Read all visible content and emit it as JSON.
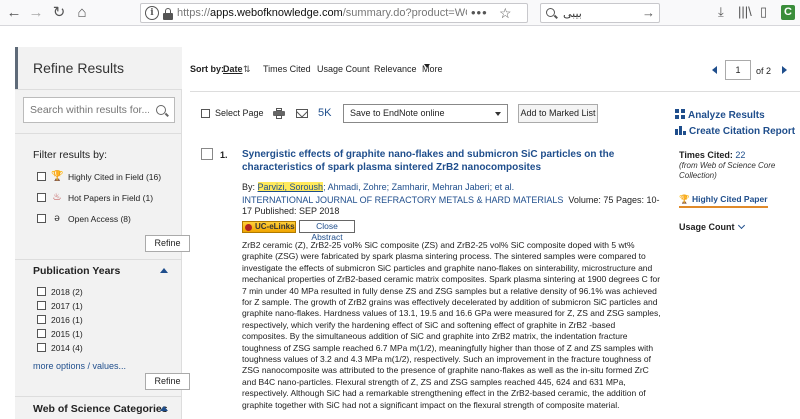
{
  "browser": {
    "url_domain": "apps.webofknowledge.com",
    "url_rest": "/summary.do?product=WOS&search_mode",
    "url_prefix": "https://",
    "search_value": "بیبی",
    "menu_dots": "•••"
  },
  "sidebar": {
    "title": "Refine Results",
    "search_placeholder": "Search within results for...",
    "filter_title": "Filter results by:",
    "filters": [
      {
        "label": "Highly Cited in Field (16)",
        "icon": "trophy-icon"
      },
      {
        "label": "Hot Papers in Field (1)",
        "icon": "flame-icon"
      },
      {
        "label": "Open Access (8)",
        "icon": "open-access-icon"
      }
    ],
    "refine_label": "Refine",
    "pub_years_title": "Publication Years",
    "years": [
      "2018 (2)",
      "2017 (1)",
      "2016 (1)",
      "2015 (1)",
      "2014 (4)"
    ],
    "more_options": "more options / values...",
    "wos_categories_title": "Web of Science Categories"
  },
  "toolbar": {
    "sort_label": "Sort by:",
    "sort_options": [
      "Date",
      "Times Cited",
      "Usage Count",
      "Relevance",
      "More"
    ],
    "page_current": "1",
    "page_of": "of",
    "page_total": "2"
  },
  "actions": {
    "select_page": "Select Page",
    "five_k": "5K",
    "endnote_option": "Save to EndNote online",
    "add_marked": "Add to Marked List",
    "analyze": "Analyze Results",
    "citation_report": "Create Citation Report"
  },
  "record": {
    "number": "1.",
    "title": "Synergistic effects of graphite nano-flakes and submicron SiC particles on the characteristics of spark plasma sintered ZrB2 nanocomposites",
    "by": "By:",
    "author_highlight": "Parvizi, Soroush",
    "authors_rest": "; Ahmadi, Zohre; Zamharir, Mehran Jaberi; et al.",
    "journal": "INTERNATIONAL JOURNAL OF REFRACTORY METALS & HARD MATERIALS",
    "details": "Volume: 75   Pages: 10-17   Published: SEP 2018",
    "uc_elinks": "UC-eLinks",
    "close_abstract": "Close Abstract",
    "abstract": "ZrB2 ceramic (Z), ZrB2-25 vol% SiC composite (ZS) and ZrB2-25 vol% SiC composite doped with 5 wt% graphite (ZSG) were fabricated by spark plasma sintering process. The sintered samples were compared to investigate the effects of submicron SiC particles and graphite nano-flakes on sinterability, microstructure and mechanical properties of ZrB2-based ceramic matrix composites. Spark plasma sintering at 1900 degrees C for 7 min under 40 MPa resulted in fully dense ZS and ZSG samples but a relative density of 96.1% was achieved for Z sample. The growth of ZrB2 grains was effectively decelerated by addition of submicron SiC particles and graphite nano-flakes. Hardness values of 13.1, 19.5 and 16.6 GPa were measured for Z, ZS and ZSG samples, respectively, which verify the hardening effect of SiC and softening effect of graphite in ZrB2 -based composites. By the simultaneous addition of SiC and graphite into ZrB2 matrix, the indentation fracture toughness of ZSG sample reached 6.7 MPa m(1/2), meaningfully higher than those of Z and ZS samples with toughness values of 3.2 and 4.3 MPa m(1/2), respectively. Such an improvement in the fracture toughness of ZSG nanocomposite was attributed to the presence of graphite nano-flakes as well as the in-situ formed ZrC and B4C nano-particles. Flexural strength of Z, ZS and ZSG samples reached 445, 624 and 631 MPa, respectively. Although SiC had a remarkable strengthening effect in the ZrB2-based ceramic, the addition of graphite together with SiC had not a significant impact on the flexural strength of composite material.",
    "times_cited_label": "Times Cited:",
    "times_cited_value": "22",
    "wos_note": "(from Web of Science Core Collection)",
    "highly_cited": "Highly Cited Paper",
    "usage_count": "Usage Count"
  }
}
